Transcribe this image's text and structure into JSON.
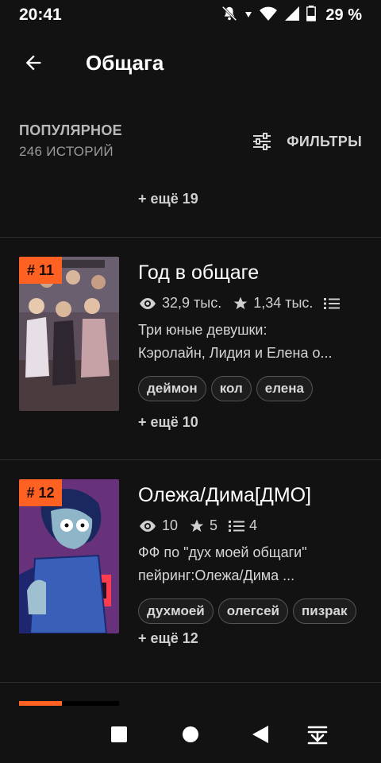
{
  "status_bar": {
    "time": "20:41",
    "battery": "29 %",
    "icons": [
      "mute-icon",
      "vibrate-icon",
      "wifi-icon",
      "signal-icon",
      "battery-icon"
    ]
  },
  "app_bar": {
    "title": "Общага"
  },
  "list_header": {
    "sort": "ПОПУЛЯРНОЕ",
    "count": "246 ИСТОРИЙ",
    "filters": "ФИЛЬТРЫ"
  },
  "prev_more": "+ ещё 19",
  "stories": [
    {
      "rank": "# 11",
      "title": "Год в общаге",
      "views": "32,9 тыс.",
      "votes": "1,34 тыс.",
      "parts": "",
      "desc_1": "Три юные девушки:",
      "desc_2": "Кэролайн, Лидия и Елена о...",
      "tags": [
        "деймон",
        "кол",
        "елена"
      ],
      "more": "+ ещё 10"
    },
    {
      "rank": "# 12",
      "title": "Олежа/Дима[ДМО]",
      "views": "10",
      "votes": "5",
      "parts": "4",
      "desc_1": "ФФ по \"дух моей общаги\"",
      "desc_2": "пейринг:Олежа/Дима ...",
      "tags": [
        "духмоей",
        "олегсей",
        "пизрак"
      ],
      "more": "+ ещё 12"
    }
  ],
  "colors": {
    "accent": "#ff6122",
    "background": "#121212"
  }
}
